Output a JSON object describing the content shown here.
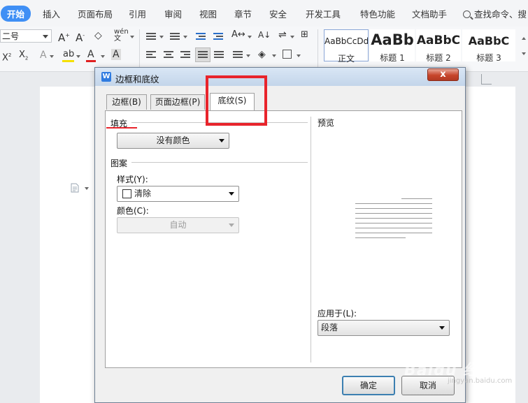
{
  "menu": {
    "tabs": [
      "开始",
      "插入",
      "页面布局",
      "引用",
      "审阅",
      "视图",
      "章节",
      "安全",
      "开发工具",
      "特色功能",
      "文档助手"
    ],
    "active_tab": "开始",
    "search_label": "查找命令、搜"
  },
  "ribbon": {
    "font_size": "二号",
    "styles": [
      {
        "sample": "AaBbCcDd",
        "label": "正文"
      },
      {
        "sample": "AaBb",
        "label": "标题 1"
      },
      {
        "sample": "AaBbC",
        "label": "标题 2"
      },
      {
        "sample": "AaBbC",
        "label": "标题 3"
      }
    ],
    "colors": {
      "highlight": "#f5e000",
      "font_color": "#e02020",
      "accent": "#3f8ff5"
    }
  },
  "dialog": {
    "title": "边框和底纹",
    "close_label": "x",
    "tabs": [
      "边框(B)",
      "页面边框(P)",
      "底纹(S)"
    ],
    "active_tab": "底纹(S)",
    "fill_section": "填充",
    "fill_color_value": "没有颜色",
    "pattern_section": "图案",
    "style_label": "样式(Y):",
    "style_value": "清除",
    "color_label": "颜色(C):",
    "color_value": "自动",
    "preview_label": "预览",
    "apply_to_label": "应用于(L):",
    "apply_to_value": "段落",
    "ok_label": "确定",
    "cancel_label": "取消"
  },
  "watermark": {
    "text": "Baidu 经验",
    "sub": "jingyan.baidu.com"
  },
  "annotation_color": "#e8242c"
}
